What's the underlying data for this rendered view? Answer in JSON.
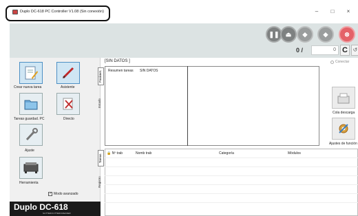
{
  "window": {
    "title": "Duplo DC-618 PC Controller V1.08  (Sin conexión)",
    "minimize": "–",
    "maximize": "□",
    "close": "×"
  },
  "header": {
    "counter_left": "0 /",
    "counter_right": "0",
    "clear_label": "C",
    "buttons": [
      "pause-icon",
      "eject-icon",
      "sheet-feed-icon",
      "cycle-icon",
      "stop-icon"
    ]
  },
  "sidebar": {
    "items": [
      {
        "label": "Crear nueva tarea",
        "icon": "new-task-icon"
      },
      {
        "label": "Asistente",
        "icon": "assistant-pen-icon"
      },
      {
        "label": "Tareas guardad. PC",
        "icon": "saved-tasks-folder-icon"
      },
      {
        "label": "Directo",
        "icon": "direct-scissors-icon"
      },
      {
        "label": "Ajuste",
        "icon": "wrench-icon"
      },
      {
        "label": "Herramienta",
        "icon": "machine-tool-icon"
      }
    ],
    "modo_avanzado": "Modo avanzado",
    "modo_checked": "✓",
    "brand": "Duplo DC-618",
    "brand_sub": "SLITTER/CUTTER/CREASER"
  },
  "main": {
    "status_label": "[SIN DATOS ]",
    "upper_tabs": [
      "Parámet.",
      "Estado"
    ],
    "resumen_label": "Resumen tareas",
    "resumen_value": "SIN DATOS",
    "lower_tabs": [
      "Tareas",
      "Registro"
    ],
    "columns": [
      "Nº trab",
      "Nomb trab",
      "Categoría",
      "Módulos"
    ]
  },
  "right": {
    "conectar": "Conectar",
    "cola_descarga": "Cola descarga",
    "ajustes_funcion": "Ajustes de función"
  },
  "colors": {
    "header_band": "#dce3e3",
    "stop_red": "#e46268",
    "brand_bg": "#1a1a1a"
  }
}
